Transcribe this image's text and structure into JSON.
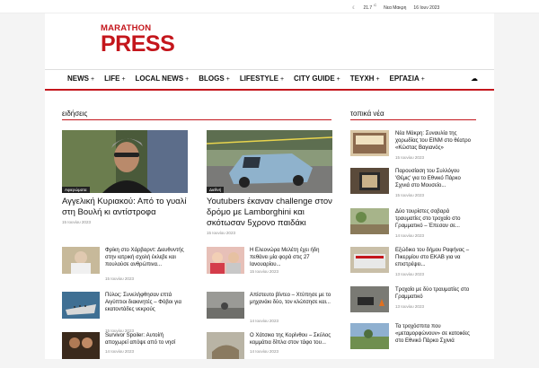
{
  "topbar": {
    "temp": "21.7",
    "unit": "C",
    "location": "Νεα Μακρη",
    "date": "16 Ιουν 2023"
  },
  "logo": {
    "line1": "MARATHON",
    "line2": "PRESS"
  },
  "nav": {
    "items": [
      {
        "label": "NEWS"
      },
      {
        "label": "LIFE"
      },
      {
        "label": "LOCAL NEWS"
      },
      {
        "label": "BLOGS"
      },
      {
        "label": "LIFESTYLE"
      },
      {
        "label": "CITY GUIDE"
      },
      {
        "label": "ΤΕΥΧΗ"
      },
      {
        "label": "ΕΡΓΑΣΙΑ"
      }
    ],
    "plus": "+"
  },
  "sections": {
    "news": "ειδήσεις",
    "local": "τοπικά νέα"
  },
  "featured": [
    {
      "category": "Αφιερώματα",
      "title": "Αγγελική Κυριακού: Από το γυαλί στη Βουλή κι αντίστροφα",
      "date": "15 Ιουνίου 2023"
    },
    {
      "category": "Διεθνή",
      "title": "Youtubers έκαναν challenge στον δρόμο με Lamborghini και σκότωσαν 5χρονο παιδάκι",
      "date": "15 Ιουνίου 2023"
    }
  ],
  "left_list": [
    {
      "title": "Φρίκη στο Χάρβαρντ: Διευθυντής στην ιατρική σχολή έκλεβε και πουλούσε ανθρώπινα...",
      "date": "15 Ιουνίου 2023"
    },
    {
      "title": "Πύλος: Συνελήφθησαν επτά Αιγύπτιοι διακινητές – Φόβοι για εκατοντάδες νεκρούς",
      "date": "15 Ιουνίου 2023"
    },
    {
      "title": "Survivor Spoiler: Αυτοί/ή αποχωρεί απόψε από το νησί",
      "date": "14 Ιουνίου 2023"
    }
  ],
  "mid_list": [
    {
      "title": "Η Ελεονώρα Μελέτη έχει ήδη πεθάνει μία φορά στις 27 Ιανουαρίου...",
      "date": "15 Ιουνίου 2023"
    },
    {
      "title": "Απίστευτο βίντεο – Χτύπησε με το μηχανάκι δύο, τον κλώτσησε και...",
      "date": "14 Ιουνίου 2023"
    },
    {
      "title": "Ο Χάτσικο της Κορίνθου – Σκύλος κομμάτια δίπλα στον τάφο του...",
      "date": "14 Ιουνίου 2023"
    }
  ],
  "local_list": [
    {
      "title": "Νέα Μάκρη: Συναυλία της χορωδίας του ΕΙΝΜ στο θέατρο «Κώστας Βαγιανός»",
      "date": "15 Ιουνίου 2023"
    },
    {
      "title": "Παρουσίαση του Συλλόγου 'Θέμις' για το Εθνικό Πάρκο Σχινιά στο Μουσείο...",
      "date": "15 Ιουνίου 2023"
    },
    {
      "title": "Δύο τουρίστες σοβαρά τραυματίες στο τροχαίο στο Γραμματικό – Έπεσαν σε...",
      "date": "14 Ιουνίου 2023"
    },
    {
      "title": "Εξώδικο του δήμου Ραφήνας – Πικερμίου στο ΕΚΑΒ για να επιστρέψει...",
      "date": "13 Ιουνίου 2023"
    },
    {
      "title": "Τροχαίο με δύο τραυματίες στο Γραμματικό",
      "date": "13 Ιουνίου 2023"
    },
    {
      "title": "Τα τροχόσπιτα που «μεταμορφώνουν» σε κατοικίες στο Εθνικό Πάρκο Σχινιά",
      "date": ""
    }
  ]
}
